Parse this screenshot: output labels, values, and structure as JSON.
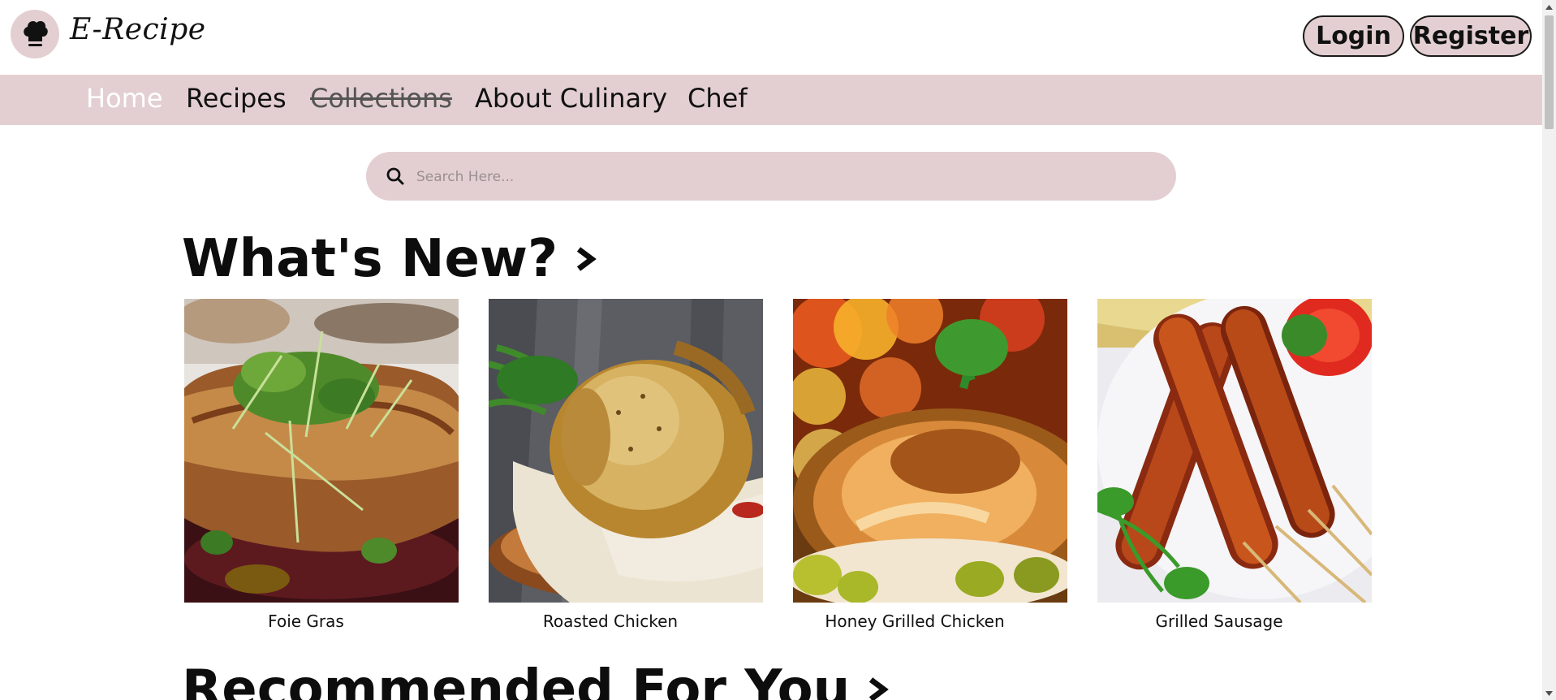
{
  "header": {
    "brand": "E-Recipe",
    "login_label": "Login",
    "register_label": "Register"
  },
  "nav": {
    "items": [
      {
        "label": "Home",
        "state": "active"
      },
      {
        "label": "Recipes",
        "state": "normal"
      },
      {
        "label": "Collections",
        "state": "struck"
      },
      {
        "label": "About Culinary",
        "state": "normal"
      },
      {
        "label": "Chef",
        "state": "normal"
      }
    ]
  },
  "search": {
    "placeholder": "Search Here...",
    "value": ""
  },
  "sections": {
    "whats_new": "What's New?",
    "recommended": "Recommended For You"
  },
  "recipes": [
    {
      "name": "Foie Gras"
    },
    {
      "name": "Roasted Chicken"
    },
    {
      "name": "Honey Grilled Chicken"
    },
    {
      "name": "Grilled Sausage"
    }
  ],
  "colors": {
    "accent": "#e3cfd1",
    "nav_active": "#ffffff",
    "text": "#111111"
  },
  "icons": {
    "logo": "chef-hat-icon",
    "search": "search-icon",
    "section_arrow": "chevron-right-icon"
  }
}
